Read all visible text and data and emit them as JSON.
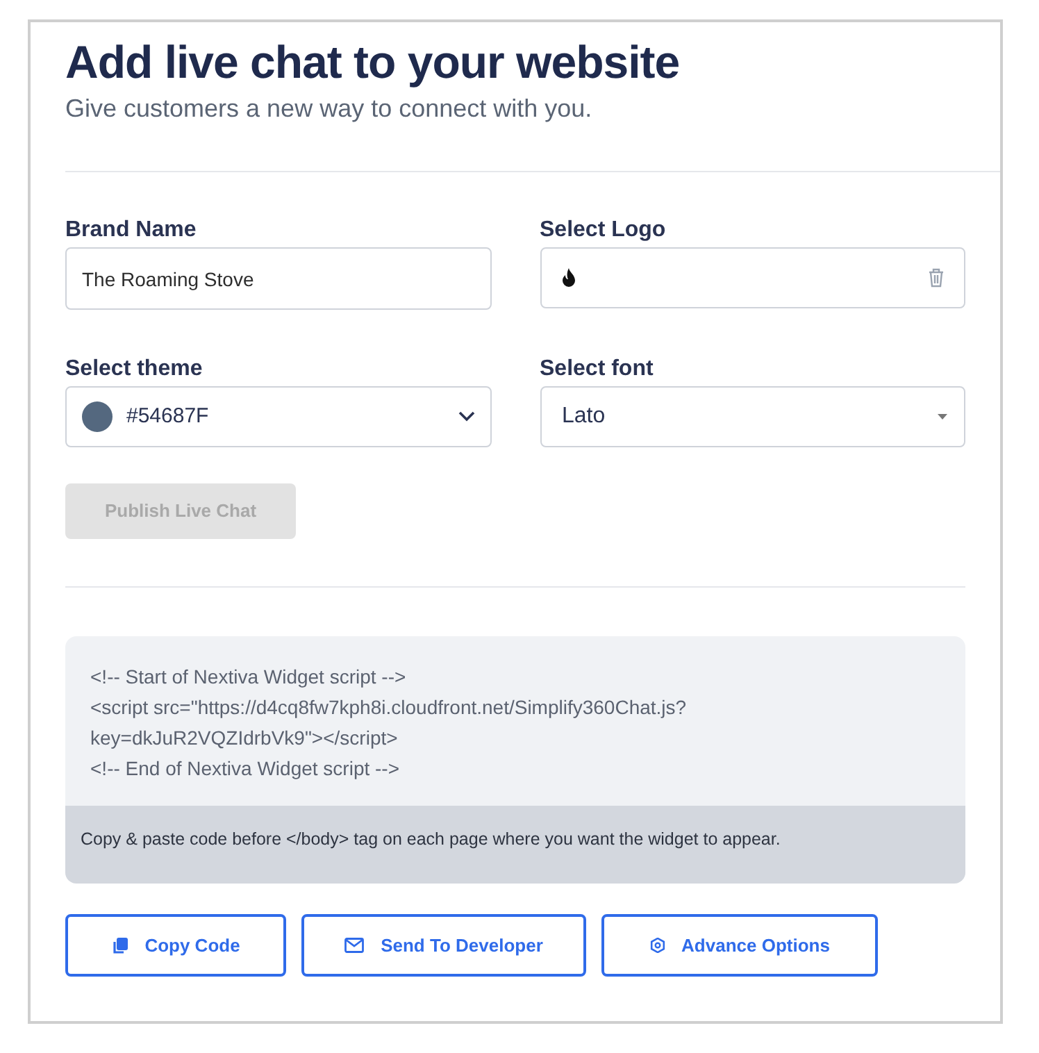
{
  "header": {
    "title": "Add live chat to your website",
    "subtitle": "Give customers a new way to connect with you."
  },
  "form": {
    "brand_name": {
      "label": "Brand Name",
      "value": "The Roaming Stove"
    },
    "logo": {
      "label": "Select Logo"
    },
    "theme": {
      "label": "Select theme",
      "value": "#54687F",
      "color": "#54687f"
    },
    "font": {
      "label": "Select font",
      "value": "Lato"
    }
  },
  "publish_button": {
    "label": "Publish Live Chat",
    "disabled": true
  },
  "code_box": {
    "lines": [
      "<!-- Start of Nextiva Widget script -->",
      "<script src=\"https://d4cq8fw7kph8i.cloudfront.net/Simplify360Chat.js?",
      "key=dkJuR2VQZIdrbVk9\"></script>",
      "<!-- End of Nextiva Widget script -->"
    ],
    "note": "Copy & paste code before </body> tag on each page where you want the widget to appear."
  },
  "actions": [
    {
      "kind": "copy",
      "label": "Copy Code"
    },
    {
      "kind": "mail",
      "label": "Send To Developer"
    },
    {
      "kind": "gear",
      "label": "Advance Options"
    }
  ]
}
